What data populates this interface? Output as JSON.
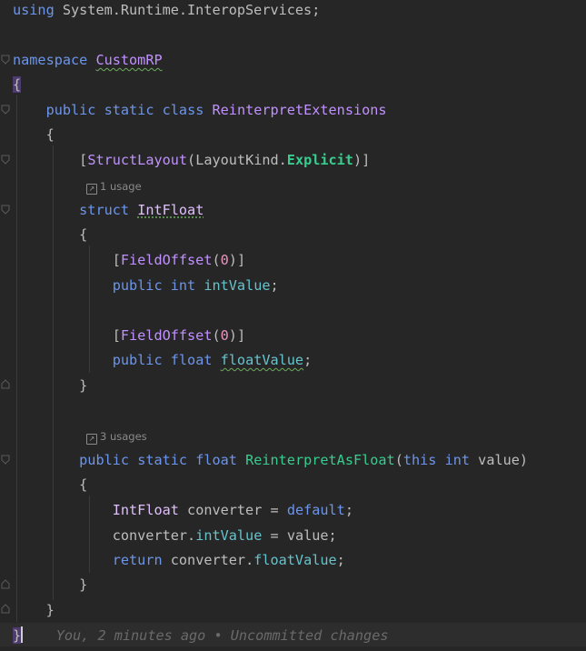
{
  "code": {
    "l1": {
      "kw": "using",
      "ns": "System.Runtime.InteropServices",
      "end": ";"
    },
    "l3": {
      "kw": "namespace",
      "name": "CustomRP"
    },
    "l4": {
      "brace": "{"
    },
    "l5": {
      "mod1": "public",
      "mod2": "static",
      "mod3": "class",
      "name": "ReinterpretExtensions"
    },
    "l6": {
      "brace": "{"
    },
    "l7": {
      "open": "[",
      "attr": "StructLayout",
      "paren_open": "(",
      "type": "LayoutKind",
      "dot": ".",
      "value": "Explicit",
      "paren_close": ")",
      "close": "]"
    },
    "hint1": {
      "icon": "↗",
      "text": "1 usage"
    },
    "l8": {
      "kw": "struct",
      "name": "IntFloat"
    },
    "l9": {
      "brace": "{"
    },
    "l10": {
      "open": "[",
      "attr": "FieldOffset",
      "paren_open": "(",
      "num": "0",
      "paren_close": ")",
      "close": "]"
    },
    "l11": {
      "mod": "public",
      "type": "int",
      "name": "intValue",
      "end": ";"
    },
    "l13": {
      "open": "[",
      "attr": "FieldOffset",
      "paren_open": "(",
      "num": "0",
      "paren_close": ")",
      "close": "]"
    },
    "l14": {
      "mod": "public",
      "type": "float",
      "name": "floatValue",
      "end": ";"
    },
    "l15": {
      "brace": "}"
    },
    "hint2": {
      "icon": "↗",
      "text": "3 usages"
    },
    "l17": {
      "mod1": "public",
      "mod2": "static",
      "type": "float",
      "name": "ReinterpretAsFloat",
      "paren_open": "(",
      "kw_this": "this",
      "ptype": "int",
      "pname": "value",
      "paren_close": ")"
    },
    "l18": {
      "brace": "{"
    },
    "l19": {
      "type": "IntFloat",
      "var": "converter",
      "eq": "=",
      "kw": "default",
      "end": ";"
    },
    "l20": {
      "obj": "converter",
      "dot": ".",
      "field": "intValue",
      "eq": "=",
      "val": "value",
      "end": ";"
    },
    "l21": {
      "kw": "return",
      "obj": "converter",
      "dot": ".",
      "field": "floatValue",
      "end": ";"
    },
    "l22": {
      "brace": "}"
    },
    "l23": {
      "brace": "}"
    },
    "l24": {
      "brace": "}",
      "blame": "You, 2 minutes ago • Uncommitted changes"
    }
  }
}
